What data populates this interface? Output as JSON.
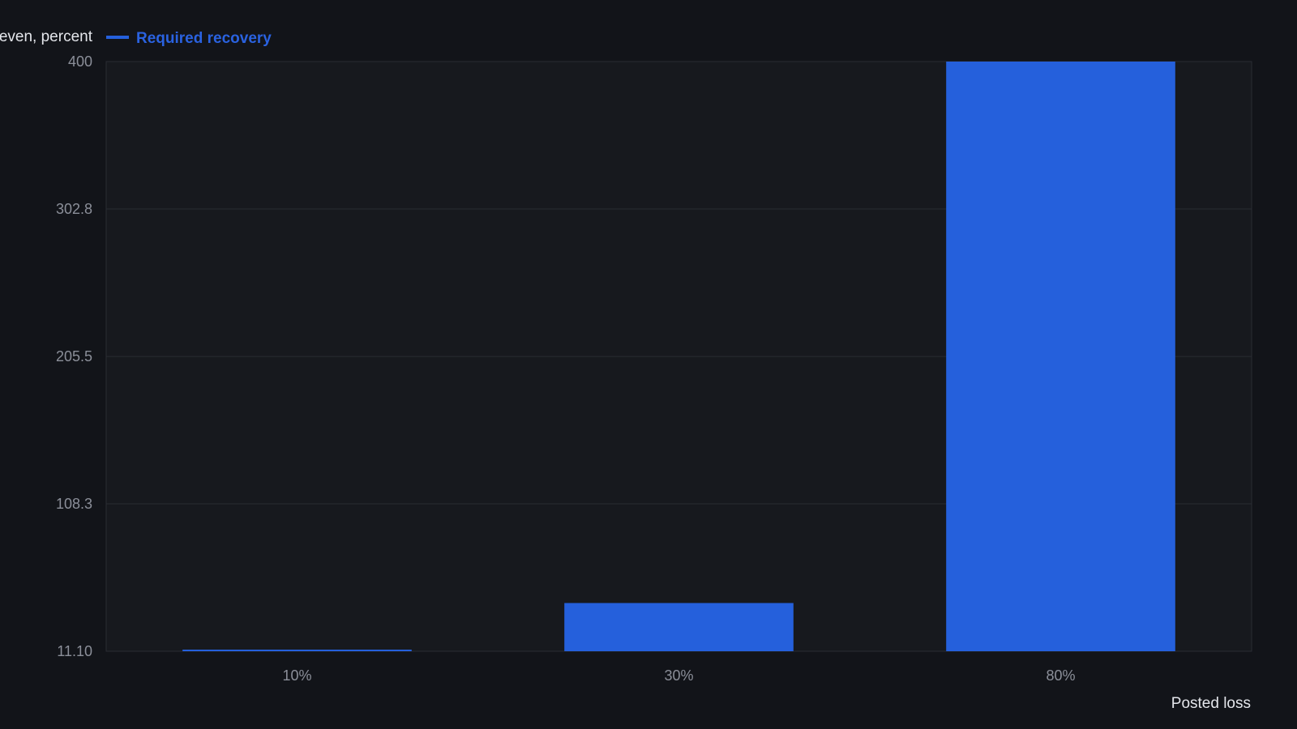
{
  "chart_data": {
    "type": "bar",
    "ylabel": "Required gain to break even, percent",
    "xlabel": "Posted loss",
    "categories": [
      "10%",
      "30%",
      "80%"
    ],
    "series": [
      {
        "name": "Required recovery",
        "values": [
          11.1,
          42.9,
          400
        ],
        "color": "#2560dc"
      }
    ],
    "y_ticks": [
      "11.10",
      "108.3",
      "205.5",
      "302.8",
      "400"
    ],
    "ylim": [
      11.1,
      400
    ],
    "grid": true,
    "legend_position": "top-left",
    "colors": {
      "background": "#121419",
      "plot_background": "#17191e",
      "grid": "#2a2d33",
      "bar": "#2560dc",
      "legend_text": "#2a62e0"
    }
  }
}
